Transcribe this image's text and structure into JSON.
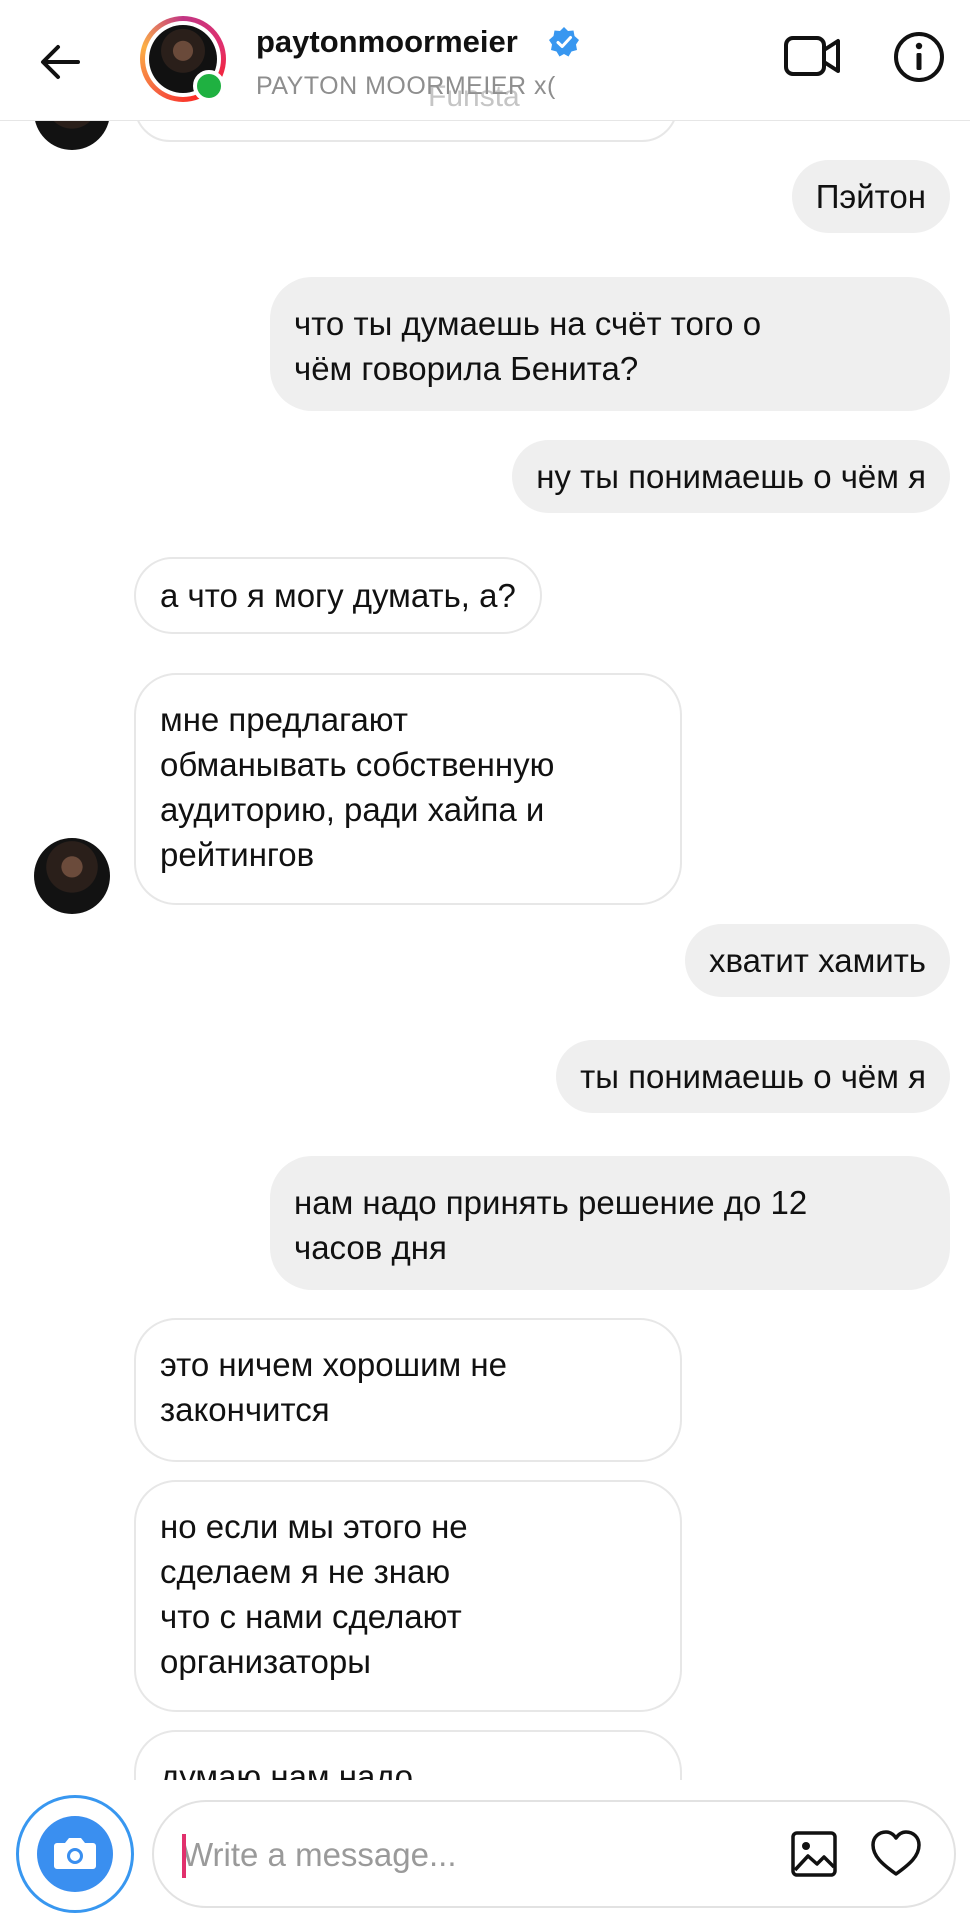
{
  "header": {
    "username": "paytonmoormeier",
    "full_name": "PAYTON MOORMEIER x(",
    "watermark": "Funsta",
    "verified": true,
    "online": true
  },
  "messages": [
    {
      "side": "outgoing",
      "lines": [
        "Пэйтон"
      ]
    },
    {
      "side": "outgoing",
      "lines": [
        "что ты думаешь на счёт того о",
        "чём говорила Бенита?"
      ]
    },
    {
      "side": "outgoing",
      "lines": [
        "ну ты понимаешь о чём я"
      ]
    },
    {
      "side": "incoming",
      "lines": [
        "а что я могу думать, а?"
      ]
    },
    {
      "side": "incoming",
      "lines": [
        "мне предлагают",
        "обманывать собственную",
        "аудиторию, ради хайпа и",
        "рейтингов"
      ]
    },
    {
      "side": "outgoing",
      "lines": [
        "хватит хамить"
      ]
    },
    {
      "side": "outgoing",
      "lines": [
        "ты понимаешь о чём я"
      ]
    },
    {
      "side": "outgoing",
      "lines": [
        "нам надо принять решение до 12",
        "часов дня"
      ]
    },
    {
      "side": "incoming",
      "lines": [
        "это ничем хорошим не",
        "закончится"
      ]
    },
    {
      "side": "incoming",
      "lines": [
        "но если мы этого не",
        "сделаем я не знаю",
        "что с нами сделают",
        "организаторы"
      ]
    },
    {
      "side": "incoming",
      "lines": [
        "думаю нам надо"
      ]
    }
  ],
  "composer": {
    "placeholder": "Write a message..."
  },
  "icons": {
    "back": "arrow-left-icon",
    "verified": "verified-badge-icon",
    "video": "video-camera-icon",
    "info": "info-icon",
    "camera": "camera-icon",
    "gallery": "image-gallery-icon",
    "heart": "heart-icon"
  },
  "colors": {
    "outgoing_bubble": "#efefef",
    "incoming_border": "#e7e7e7",
    "verified_blue": "#3897f0",
    "online_green": "#1fb141",
    "camera_blue": "#3a8ff0",
    "cursor_pink": "#e1306c"
  }
}
